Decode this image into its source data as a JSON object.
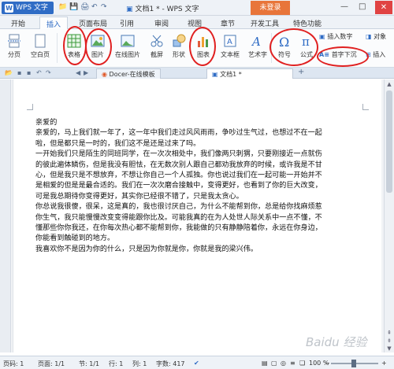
{
  "titlebar": {
    "app_menu": "WPS 文字",
    "doc_title": "文档1 * - WPS 文字",
    "login": "未登录",
    "win_min": "—",
    "win_max": "□",
    "win_close": "✕"
  },
  "tabs": [
    "开始",
    "插入",
    "页面布局",
    "引用",
    "审阅",
    "视图",
    "章节",
    "开发工具",
    "特色功能"
  ],
  "toolbar": {
    "page_break": "分页",
    "blank_page": "空白页",
    "table": "表格",
    "picture": "图片",
    "online_screenshot": "在线图片",
    "screenshot": "截屏",
    "shapes": "形状",
    "chart": "图表",
    "textbox": "文本框",
    "wordart": "艺术字",
    "symbol": "符号",
    "formula": "公式",
    "insert_number": "插入数字",
    "object": "对象",
    "dropcap": "首字下沉",
    "insert_more": "插入"
  },
  "docbar": {
    "docer_tab": "Docer-在线模板",
    "doc_tab": "文档1 *",
    "add": "+"
  },
  "document": {
    "lines": [
      "亲爱的",
      "亲爱的，马上我们就一年了，这一年中我们走过风风雨雨，争吵过生气过，也想过不在一起",
      "啦，但是都只是一时的，我们这不是还是过来了吗。",
      "一开始我们只是陌生的同班同学，在一次次相处中，我们像两只刺猬，只要刚接近一点就伤",
      "的彼此遍体鳞伤，但是我没有胆怯，在无数次别人跟自己都劝我放弃的时候，或许我是不甘",
      "心，但是我只是不想放弃，不想让你自己一个人孤独。你也说过我们在一起可能一开始并不",
      "是相爱的但是是最合适的。我们在一次次磨合接触中，变得更好，也看到了你的巨大改变，",
      "可是我总期待你变得更好，其实你已经很不错了，只是我太贪心。",
      "你总说我很傻，很呆，这是真的，我也很讨厌自己，为什么不能帮到你，总是给你找麻烦惹",
      "你生气，我只能慢慢改变变得能跟你比及。可能我真的在为人处世人际关系中一点不懂，不",
      "懂那些你你我还，在你每次热心都不能帮到你，我能做的只有静静陪着你，永远在你身边，",
      "你能看到触碰到的地方。",
      "我喜欢你不是因为你的什么，只是因为你就是你，你就是我的梁兴伟。"
    ]
  },
  "statusbar": {
    "page": "页码: 1",
    "pages": "页面: 1/1",
    "section": "节: 1/1",
    "row": "行: 1",
    "col": "列: 1",
    "words": "字数: 417",
    "zoom": "100 %"
  },
  "watermark": "Baidu 经验",
  "colors": {
    "accent": "#2f6cc5",
    "login": "#e8753a",
    "annotation": "#e02020"
  }
}
